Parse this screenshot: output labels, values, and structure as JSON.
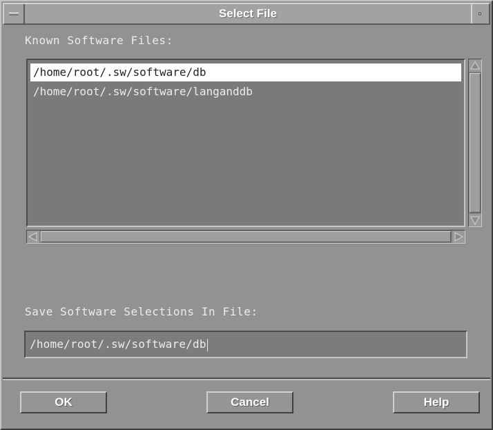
{
  "window": {
    "title": "Select File"
  },
  "known_files": {
    "label": "Known Software Files:",
    "items": [
      "/home/root/.sw/software/db",
      "/home/root/.sw/software/langanddb"
    ],
    "selected": "/home/root/.sw/software/db"
  },
  "save": {
    "label": "Save Software Selections In File:",
    "value": "/home/root/.sw/software/db"
  },
  "buttons": {
    "ok": "OK",
    "cancel": "Cancel",
    "help": "Help"
  },
  "colors": {
    "background": "#929292",
    "selection": "#ffffff",
    "text": "#ececec"
  }
}
